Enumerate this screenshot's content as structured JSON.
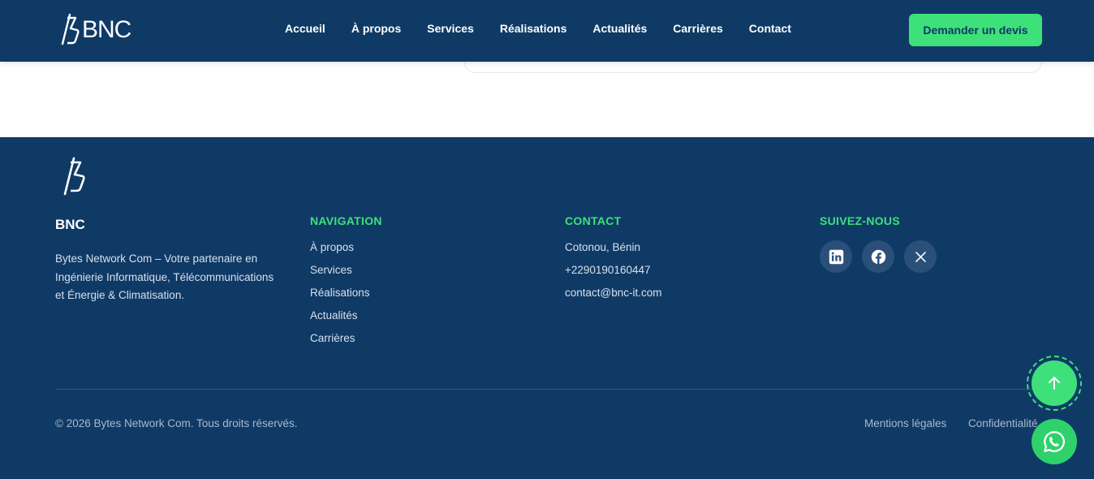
{
  "header": {
    "logo_text": "BNC",
    "nav": [
      "Accueil",
      "À propos",
      "Services",
      "Réalisations",
      "Actualités",
      "Carrières",
      "Contact"
    ],
    "cta_label": "Demander un devis"
  },
  "footer": {
    "brand_title": "BNC",
    "brand_description": "Bytes Network Com – Votre partenaire en Ingénierie Informatique, Télécommunications et Énergie & Climatisation.",
    "navigation": {
      "heading": "NAVIGATION",
      "links": [
        "À propos",
        "Services",
        "Réalisations",
        "Actualités",
        "Carrières"
      ]
    },
    "contact": {
      "heading": "CONTACT",
      "location": "Cotonou, Bénin",
      "phone": "+2290190160447",
      "email": "contact@bnc-it.com"
    },
    "social": {
      "heading": "SUIVEZ-NOUS",
      "icons": [
        "linkedin-icon",
        "facebook-icon",
        "x-icon"
      ]
    },
    "copyright": "© 2026 Bytes Network Com. Tous droits réservés.",
    "legal_links": [
      "Mentions légales",
      "Confidentialité"
    ]
  },
  "floating": {
    "scroll_top_icon": "arrow-up-icon",
    "whatsapp_icon": "whatsapp-icon"
  },
  "colors": {
    "primary": "#0f3a66",
    "accent": "#3ee07a",
    "text_light": "#d6e0ec"
  }
}
